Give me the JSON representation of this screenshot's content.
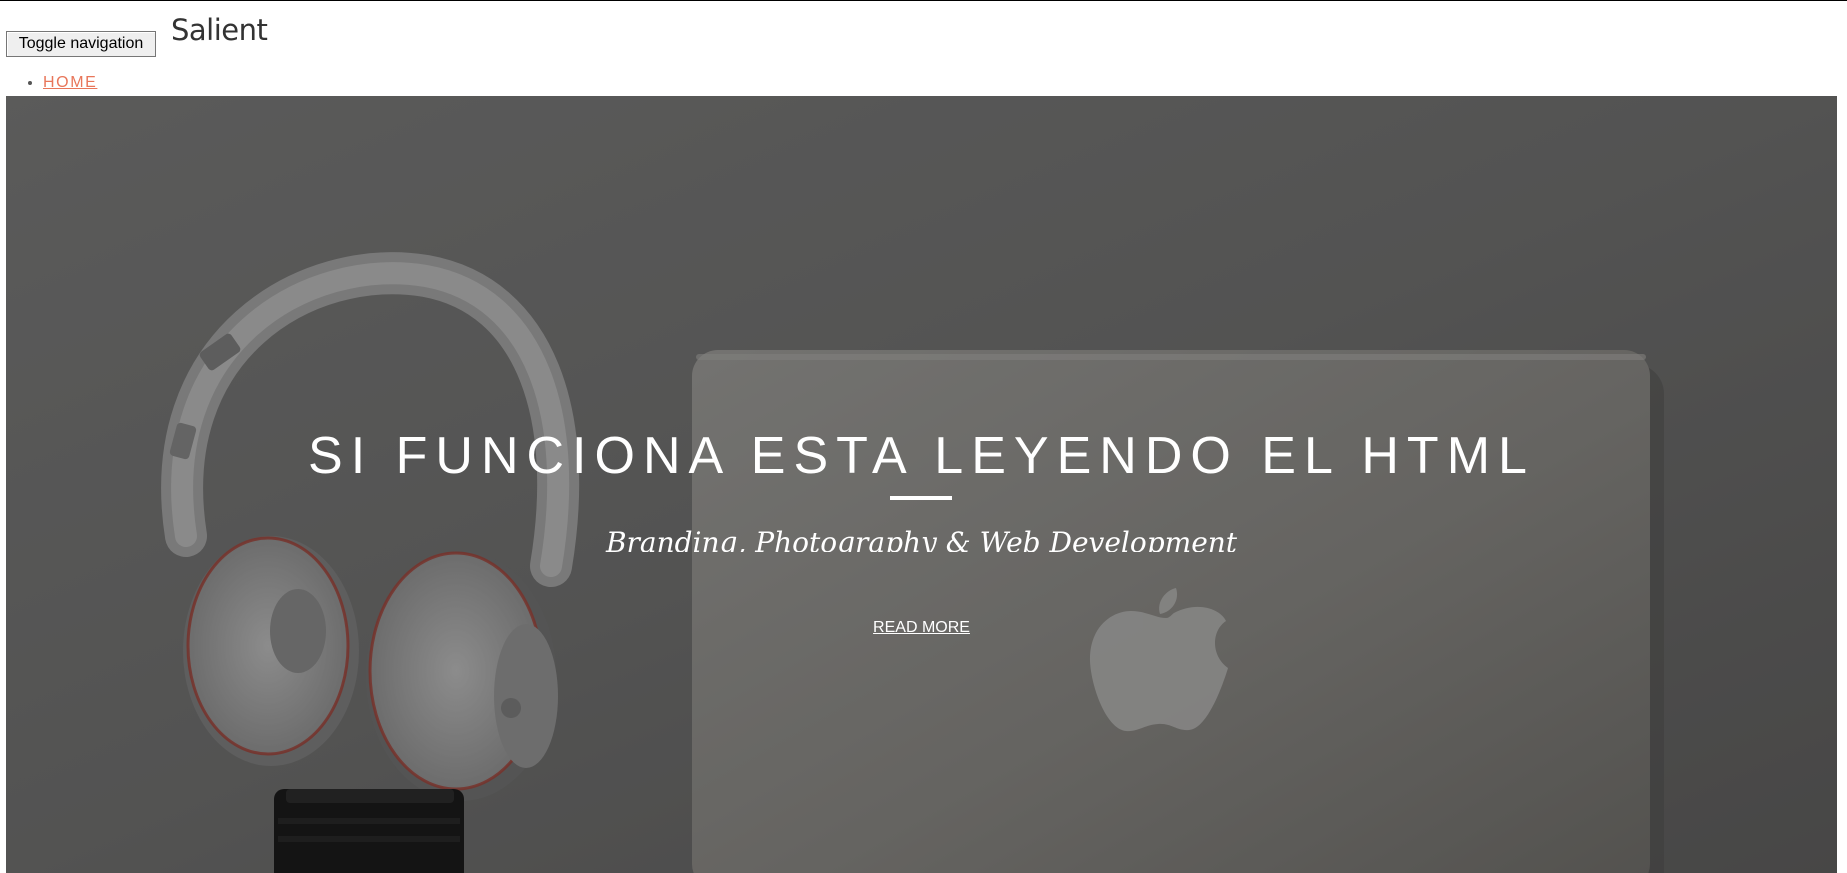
{
  "header": {
    "toggle_label": "Toggle navigation",
    "brand": "Salient"
  },
  "nav": {
    "items": [
      {
        "label": "HOME"
      }
    ],
    "link_color": "#e8765a"
  },
  "hero": {
    "title": "SI FUNCIONA ESTA LEYENDO EL HTML",
    "subtitle": "Branding, Photography & Web Development",
    "cta_label": "READ MORE"
  }
}
